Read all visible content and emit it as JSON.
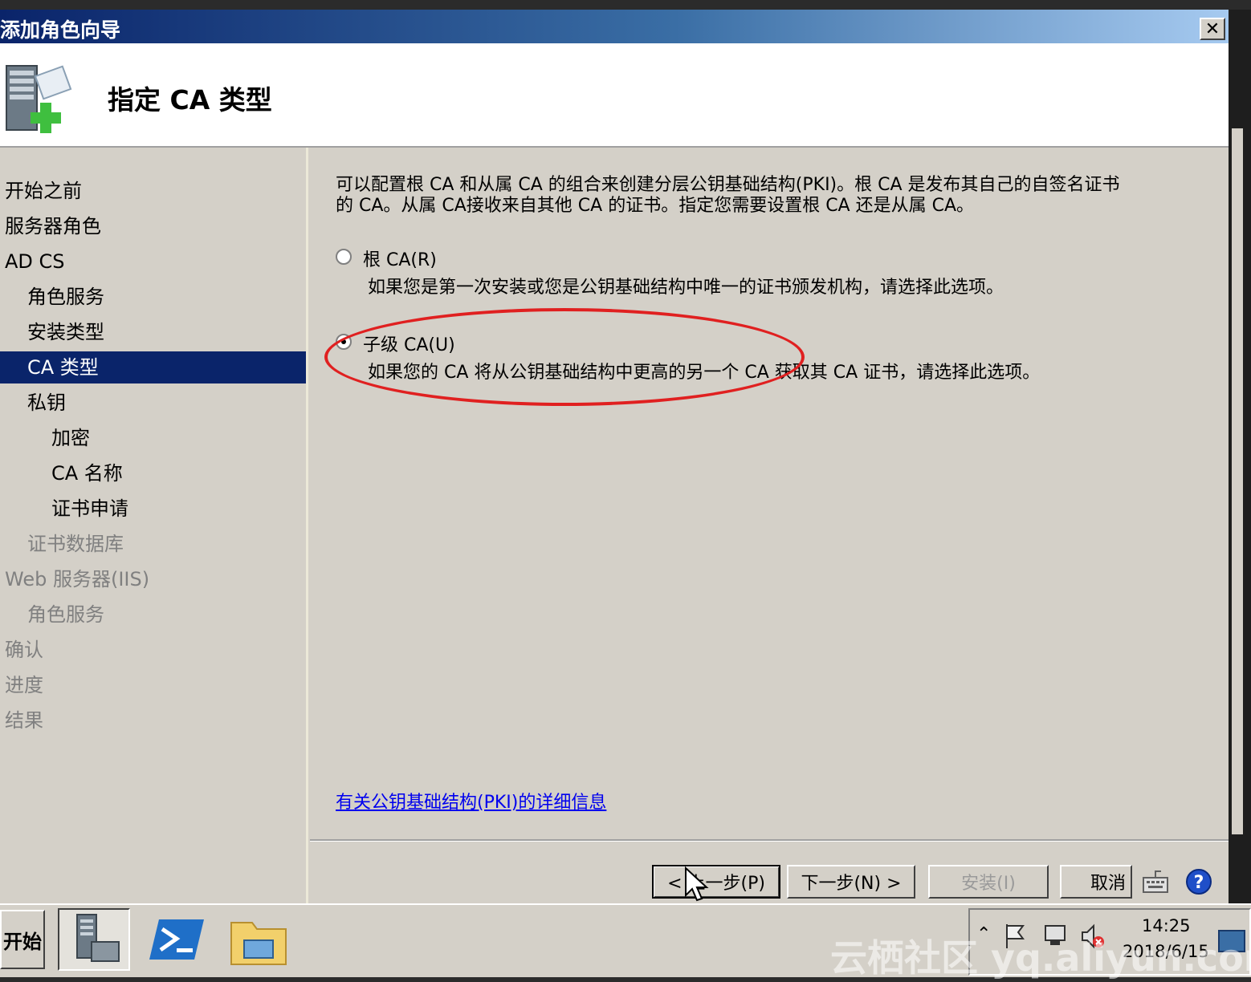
{
  "window": {
    "title": "添加角色向导",
    "close_glyph": "✕"
  },
  "header": {
    "page_title": "指定 CA 类型",
    "icon": "server-add-icon"
  },
  "sidebar": {
    "items": [
      {
        "label": "开始之前",
        "state": "normal"
      },
      {
        "label": "服务器角色",
        "state": "normal"
      },
      {
        "label": "AD CS",
        "state": "normal"
      },
      {
        "label": "角色服务",
        "state": "normal"
      },
      {
        "label": "安装类型",
        "state": "normal"
      },
      {
        "label": "CA 类型",
        "state": "selected"
      },
      {
        "label": "私钥",
        "state": "normal"
      },
      {
        "label": "加密",
        "state": "normal"
      },
      {
        "label": "CA 名称",
        "state": "normal"
      },
      {
        "label": "证书申请",
        "state": "normal"
      },
      {
        "label": "证书数据库",
        "state": "disabled"
      },
      {
        "label": "Web 服务器(IIS)",
        "state": "disabled"
      },
      {
        "label": "角色服务",
        "state": "disabled"
      },
      {
        "label": "确认",
        "state": "disabled"
      },
      {
        "label": "进度",
        "state": "disabled"
      },
      {
        "label": "结果",
        "state": "disabled"
      }
    ]
  },
  "content": {
    "intro_line1": "可以配置根 CA 和从属 CA 的组合来创建分层公钥基础结构(PKI)。根 CA 是发布其自己的自签名证书",
    "intro_line2": "的 CA。从属 CA接收来自其他 CA 的证书。指定您需要设置根 CA 还是从属 CA。",
    "options": [
      {
        "label": "根 CA(R)",
        "description": "如果您是第一次安装或您是公钥基础结构中唯一的证书颁发机构，请选择此选项。",
        "checked": false
      },
      {
        "label": "子级 CA(U)",
        "description": "如果您的 CA 将从公钥基础结构中更高的另一个 CA 获取其 CA 证书，请选择此选项。",
        "checked": true
      }
    ],
    "link": "有关公钥基础结构(PKI)的详细信息"
  },
  "buttons": {
    "prev": "< 上一步(P)",
    "next": "下一步(N) >",
    "install": "安装(I)",
    "cancel": "取消"
  },
  "taskbar": {
    "start": "开始",
    "clock_time": "14:25",
    "clock_date": "2018/6/15",
    "watermark": "云栖社区 yq.aliyun.com"
  },
  "colors": {
    "title_bar_start": "#0a246a",
    "title_bar_end": "#a6caf0",
    "selection": "#0a246a",
    "annotation": "#e02020",
    "link": "#0000ee"
  }
}
